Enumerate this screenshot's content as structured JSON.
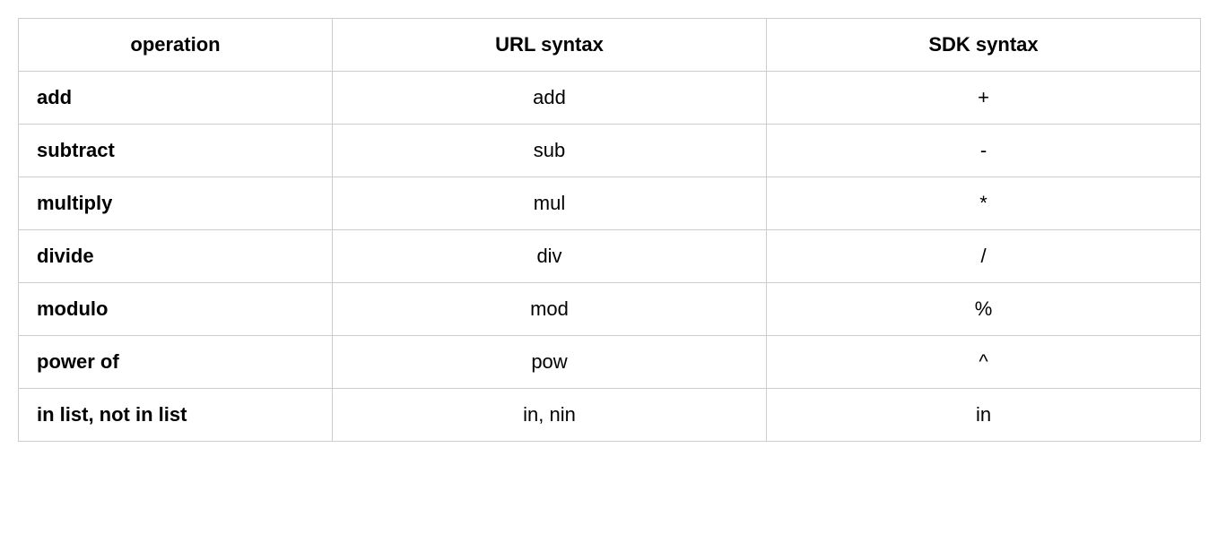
{
  "table": {
    "headers": {
      "operation": "operation",
      "url_syntax": "URL syntax",
      "sdk_syntax": "SDK syntax"
    },
    "rows": [
      {
        "operation": "add",
        "url_syntax": "add",
        "sdk_syntax": "+"
      },
      {
        "operation": "subtract",
        "url_syntax": "sub",
        "sdk_syntax": "-"
      },
      {
        "operation": "multiply",
        "url_syntax": "mul",
        "sdk_syntax": "*"
      },
      {
        "operation": "divide",
        "url_syntax": "div",
        "sdk_syntax": "/"
      },
      {
        "operation": "modulo",
        "url_syntax": "mod",
        "sdk_syntax": "%"
      },
      {
        "operation": "power of",
        "url_syntax": "pow",
        "sdk_syntax": "^"
      },
      {
        "operation": "in list, not in list",
        "url_syntax": "in, nin",
        "sdk_syntax": "in"
      }
    ]
  }
}
